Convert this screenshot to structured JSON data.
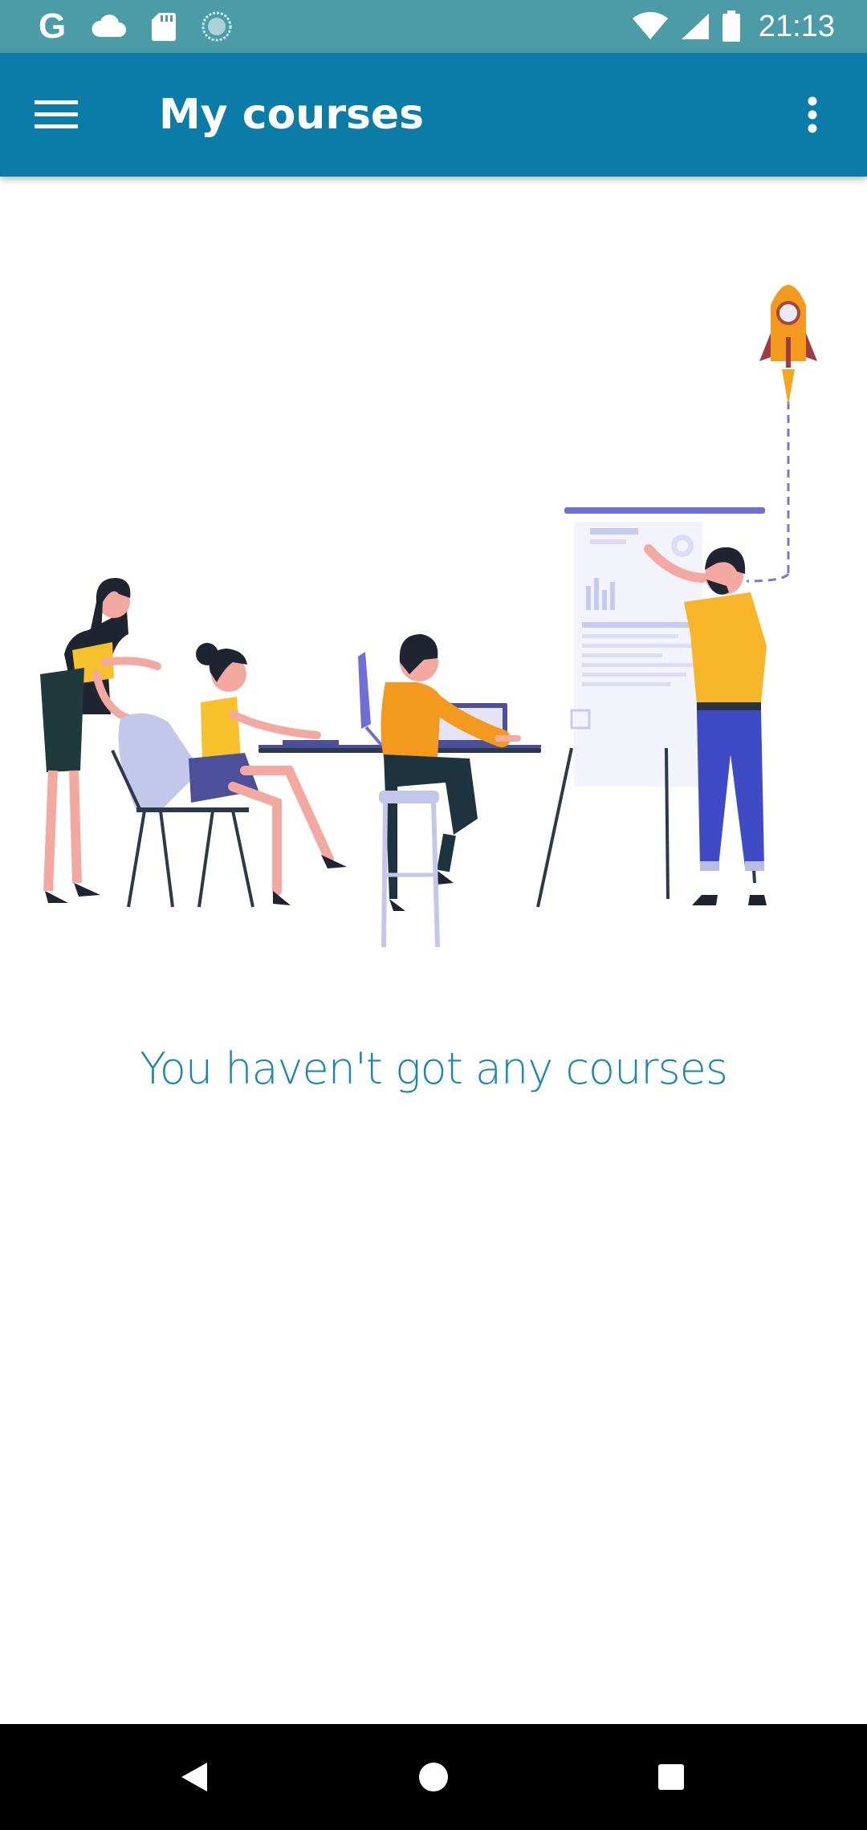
{
  "status_bar": {
    "time": "21:13",
    "left_icons": [
      "google-icon",
      "cloud-icon",
      "sd-card-icon",
      "sync-circle-icon"
    ],
    "right_icons": [
      "wifi-icon",
      "signal-icon",
      "battery-icon"
    ]
  },
  "app_bar": {
    "title": "My courses",
    "menu_icon": "hamburger-menu-icon",
    "overflow_icon": "more-vert-icon",
    "background_color": "#0b7ba8"
  },
  "empty_state": {
    "message": "You haven't got any courses",
    "message_color": "#1a87ae",
    "illustration": "team-working-illustration"
  },
  "nav_bar": {
    "buttons": [
      "back-icon",
      "home-icon",
      "recents-icon"
    ]
  }
}
